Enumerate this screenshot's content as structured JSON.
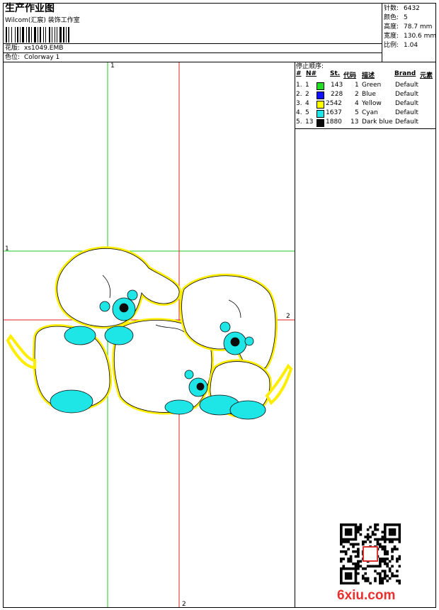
{
  "header": {
    "title": "生产作业图",
    "studio": "Wilcom(汇宸) 装饰工作室",
    "design_file_label": "花版:",
    "design_file": "xs1049.EMB",
    "colorway_label": "色位:",
    "colorway": "Colorway 1"
  },
  "stats": {
    "stitches_label": "针数:",
    "stitches": "6432",
    "colors_label": "颜色:",
    "colors": "5",
    "height_label": "高度:",
    "height": "78.7 mm",
    "width_label": "宽度:",
    "width": "130.6 mm",
    "scale_label": "比例:",
    "scale": "1.04"
  },
  "stop_sequence": {
    "title": "停止顺序:",
    "headers": {
      "num": "#",
      "n": "N#",
      "st": "St.",
      "code": "代码",
      "desc": "描述",
      "brand": "Brand",
      "elem": "元素"
    },
    "rows": [
      {
        "num": "1.",
        "n": "1",
        "color": "#22dd22",
        "st": "143",
        "code": "1",
        "desc": "Green",
        "brand": "Default"
      },
      {
        "num": "2.",
        "n": "2",
        "color": "#1010ff",
        "st": "228",
        "code": "2",
        "desc": "Blue",
        "brand": "Default"
      },
      {
        "num": "3.",
        "n": "4",
        "color": "#ffff00",
        "st": "2542",
        "code": "4",
        "desc": "Yellow",
        "brand": "Default"
      },
      {
        "num": "4.",
        "n": "5",
        "color": "#1fe6e6",
        "st": "1637",
        "code": "5",
        "desc": "Cyan",
        "brand": "Default"
      },
      {
        "num": "5.",
        "n": "13",
        "color": "#0a0a0a",
        "st": "1880",
        "code": "13",
        "desc": "Dark blue",
        "brand": "Default"
      }
    ]
  },
  "axes": {
    "v1_top": "1",
    "h1_left": "1",
    "h2_right": "2",
    "v2_bottom": "2",
    "green_color": "#22cc22",
    "red_color": "#dd2222"
  },
  "watermark": {
    "text": "6xiu.com",
    "color": "#e9302f"
  },
  "design": {
    "icon": "embroidered-puppies-artwork"
  }
}
